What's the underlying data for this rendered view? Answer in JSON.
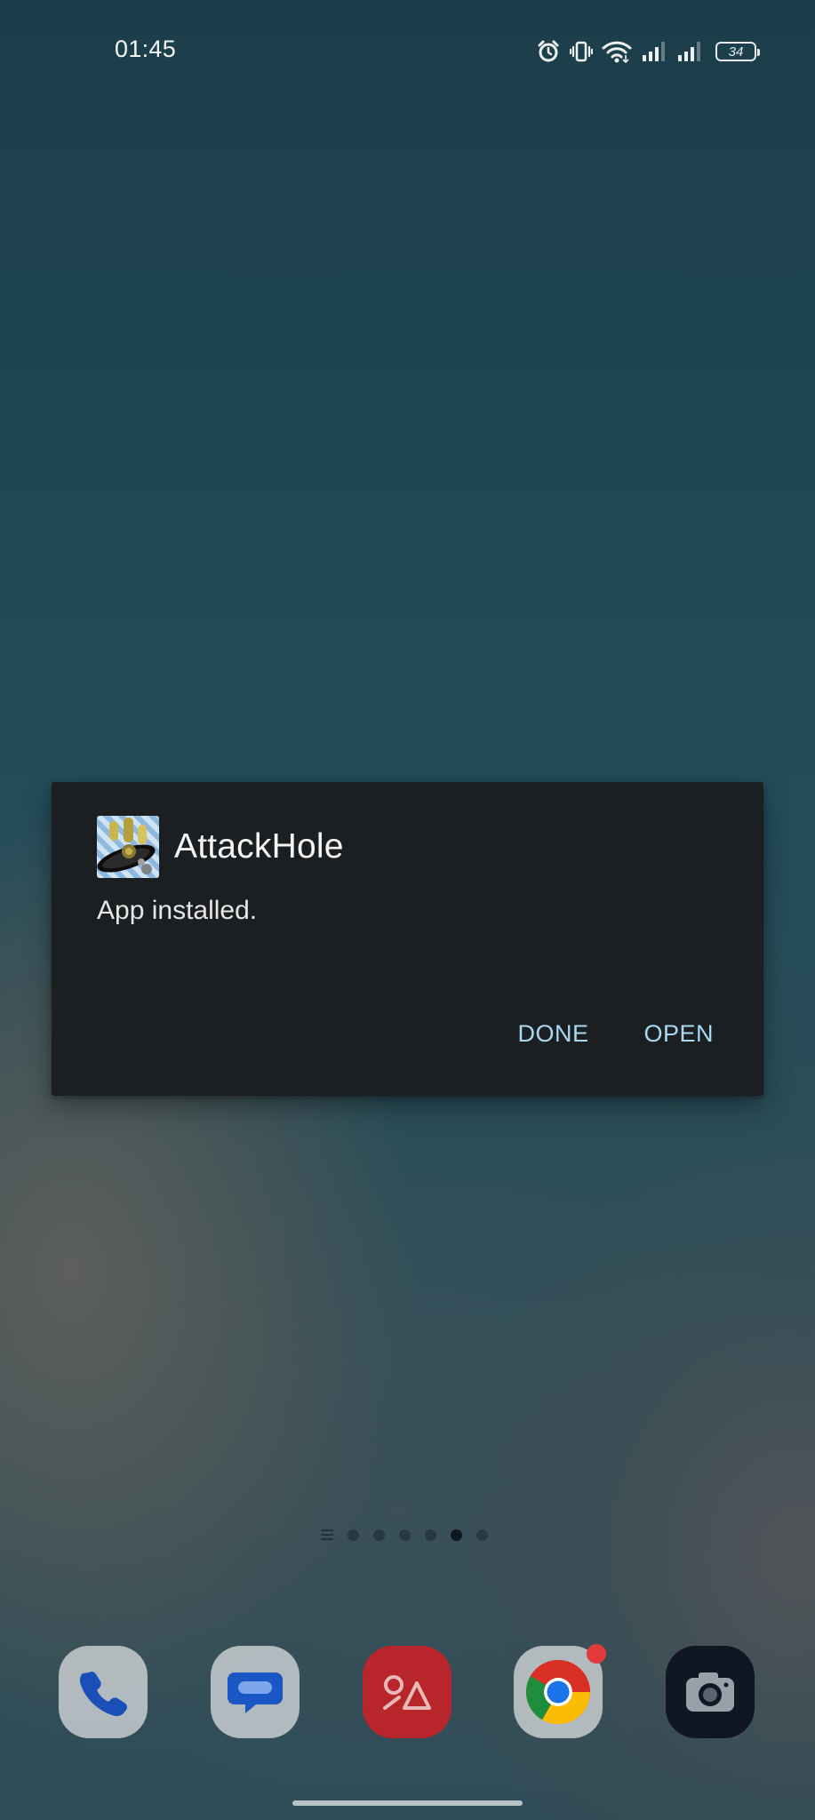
{
  "status_bar": {
    "time": "01:45",
    "battery_level": "34",
    "icons": [
      "alarm-icon",
      "vibrate-icon",
      "wifi-icon",
      "signal-1-icon",
      "signal-2-icon",
      "battery-icon"
    ]
  },
  "dialog": {
    "app_name": "AttackHole",
    "message": "App installed.",
    "done_label": "DONE",
    "open_label": "OPEN",
    "app_icon": "attackhole-app-icon"
  },
  "page_indicator": {
    "pages": 6,
    "active_index": 4
  },
  "dock": {
    "apps": [
      {
        "name": "Phone",
        "icon": "phone-icon"
      },
      {
        "name": "Messages",
        "icon": "messages-icon"
      },
      {
        "name": "Gallery",
        "icon": "gallery-icon"
      },
      {
        "name": "Chrome",
        "icon": "chrome-icon",
        "badge": true
      },
      {
        "name": "Camera",
        "icon": "camera-icon"
      }
    ]
  },
  "colors": {
    "dialog_bg": "#1b1f21",
    "button_text": "#a8d8f2",
    "badge": "#e23a3a"
  }
}
